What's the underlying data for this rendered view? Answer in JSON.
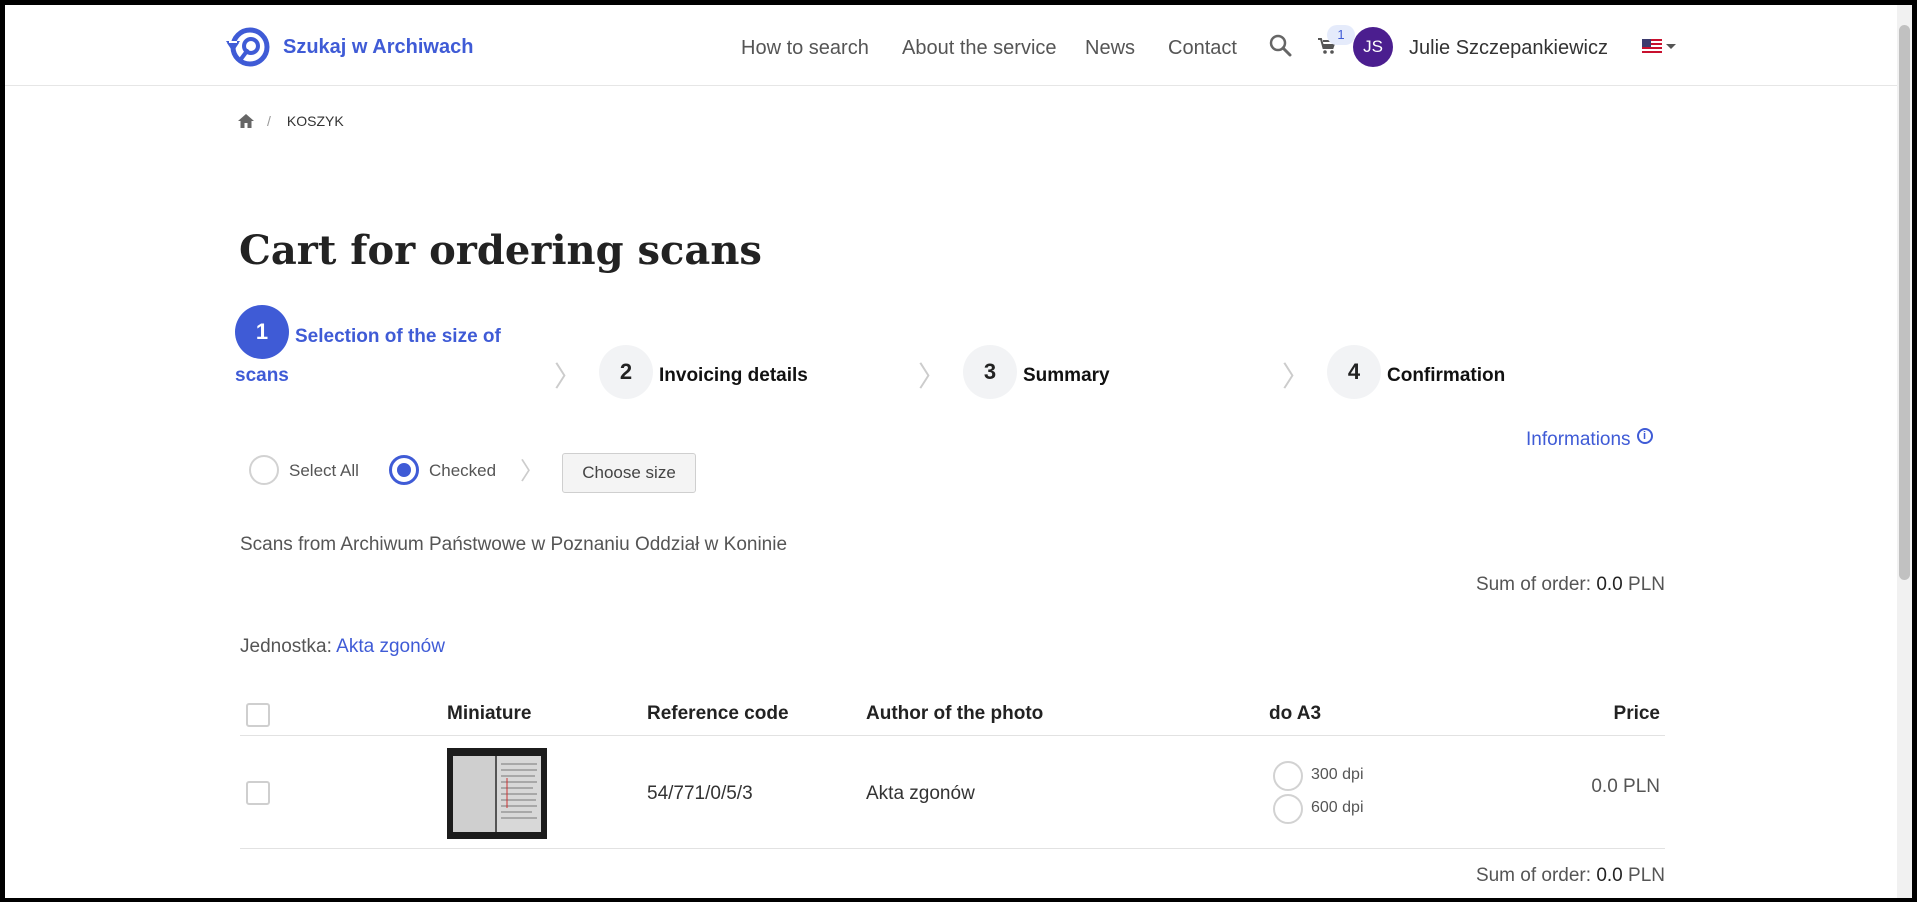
{
  "header": {
    "logo_text": "Szukaj w Archiwach",
    "nav": [
      "How to search",
      "About the service",
      "News",
      "Contact"
    ],
    "cart_count": "1",
    "avatar_initials": "JS",
    "user_name": "Julie Szczepankiewicz",
    "language_flag_icon": "us-flag-icon"
  },
  "breadcrumb": {
    "home_icon": "home-icon",
    "current": "KOSZYK"
  },
  "page_title": "Cart for ordering scans",
  "steps": [
    {
      "num": "1",
      "label": "Selection of the size of scans",
      "active": true
    },
    {
      "num": "2",
      "label": "Invoicing details",
      "active": false
    },
    {
      "num": "3",
      "label": "Summary",
      "active": false
    },
    {
      "num": "4",
      "label": "Confirmation",
      "active": false
    }
  ],
  "informations_link": "Informations",
  "selection": {
    "select_all": "Select All",
    "checked": "Checked",
    "selected_option": "Checked",
    "choose_size": "Choose size"
  },
  "scans_from": "Scans from  Archiwum Państwowe w Poznaniu Oddział w Koninie",
  "sum_order": {
    "label": "Sum of order:",
    "value": "0.0",
    "currency": "PLN"
  },
  "unit": {
    "label": "Jednostka:",
    "value": "Akta zgonów"
  },
  "table": {
    "columns": [
      "Miniature",
      "Reference code",
      "Author of the photo",
      "do A3",
      "Price"
    ],
    "rows": [
      {
        "reference_code": "54/771/0/5/3",
        "author": "Akta zgonów",
        "dpi_options": [
          "300 dpi",
          "600 dpi"
        ],
        "price": "0.0 PLN"
      }
    ]
  },
  "colors": {
    "accent": "#3f5bd6",
    "avatar": "#4b1e8f"
  }
}
